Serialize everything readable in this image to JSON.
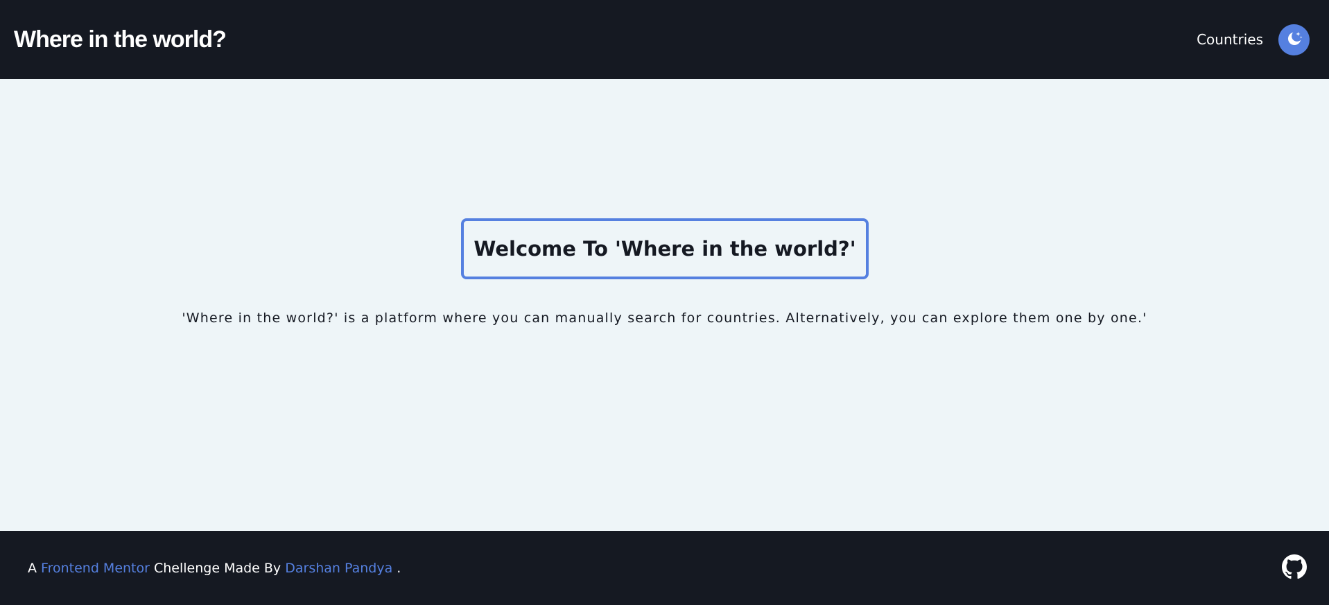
{
  "header": {
    "title": "Where in the world?",
    "nav_countries": "Countries",
    "theme_toggle_icon": "moon-stars-icon"
  },
  "main": {
    "welcome_heading": "Welcome To 'Where in the world?'",
    "description": "'Where in the world?' is a platform where you can manually search for countries. Alternatively, you can explore them one by one.'"
  },
  "footer": {
    "prefix": "A",
    "frontend_mentor_link": "Frontend Mentor",
    "middle": "Chellenge Made By",
    "author_link": "Darshan Pandya",
    "suffix": ".",
    "github_icon": "github-icon"
  },
  "colors": {
    "header_bg": "#151922",
    "page_bg": "#eef5f8",
    "accent": "#5580e0",
    "text_dark": "#151922",
    "text_light": "#ffffff"
  }
}
